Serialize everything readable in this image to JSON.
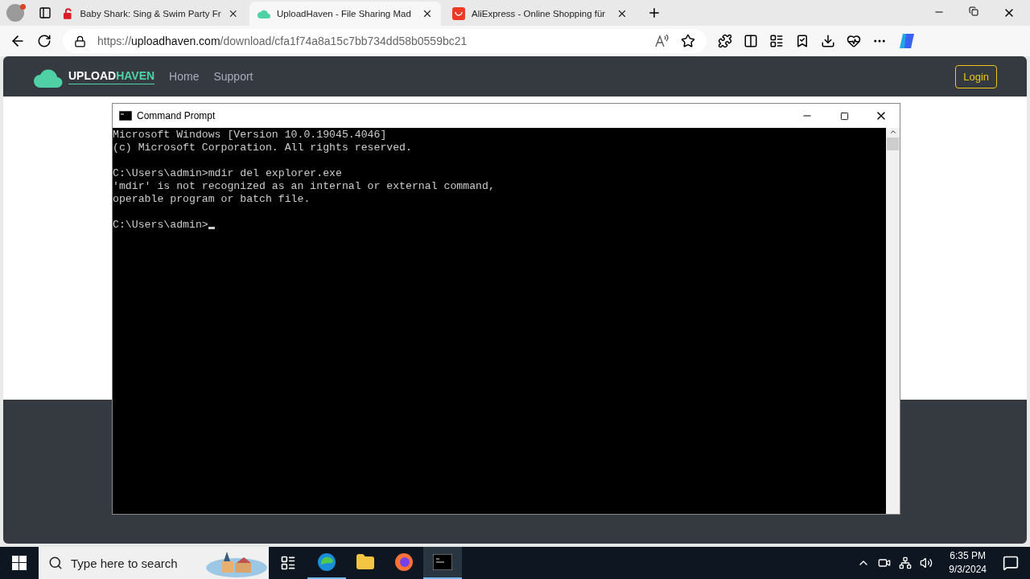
{
  "browser": {
    "tabs": [
      {
        "title": "Baby Shark: Sing & Swim Party Fr",
        "kind": "shark",
        "selected": false
      },
      {
        "title": "UploadHaven - File Sharing Mad",
        "kind": "cloud",
        "selected": true
      },
      {
        "title": "AliExpress - Online Shopping für",
        "kind": "bag",
        "selected": false
      }
    ],
    "address": {
      "scheme": "https://",
      "host": "uploadhaven.com",
      "path": "/download/cfa1f74a8a15c7bb734dd58b0559bc21"
    }
  },
  "site": {
    "logo": {
      "first": "UPLOAD",
      "second": "HAVEN"
    },
    "nav": [
      "Home",
      "Support"
    ],
    "login": "Login"
  },
  "console_window": {
    "title": "Command Prompt",
    "blocks": [
      [
        "Microsoft Windows [Version 10.0.19045.4046]",
        "(c) Microsoft Corporation. All rights reserved."
      ],
      [
        "C:\\Users\\admin>mdir del explorer.exe",
        "'mdir' is not recognized as an internal or external command,",
        "operable program or batch file."
      ]
    ],
    "prompt": "C:\\Users\\admin>"
  },
  "taskbar": {
    "search_placeholder": "Type here to search",
    "apps": [
      {
        "kind": "edge",
        "running": true,
        "selected": false
      },
      {
        "kind": "folder",
        "running": false,
        "selected": false
      },
      {
        "kind": "firefox",
        "running": false,
        "selected": false
      },
      {
        "kind": "terminal",
        "running": true,
        "selected": true
      }
    ],
    "time": "6:35 PM",
    "date": "9/3/2024"
  }
}
